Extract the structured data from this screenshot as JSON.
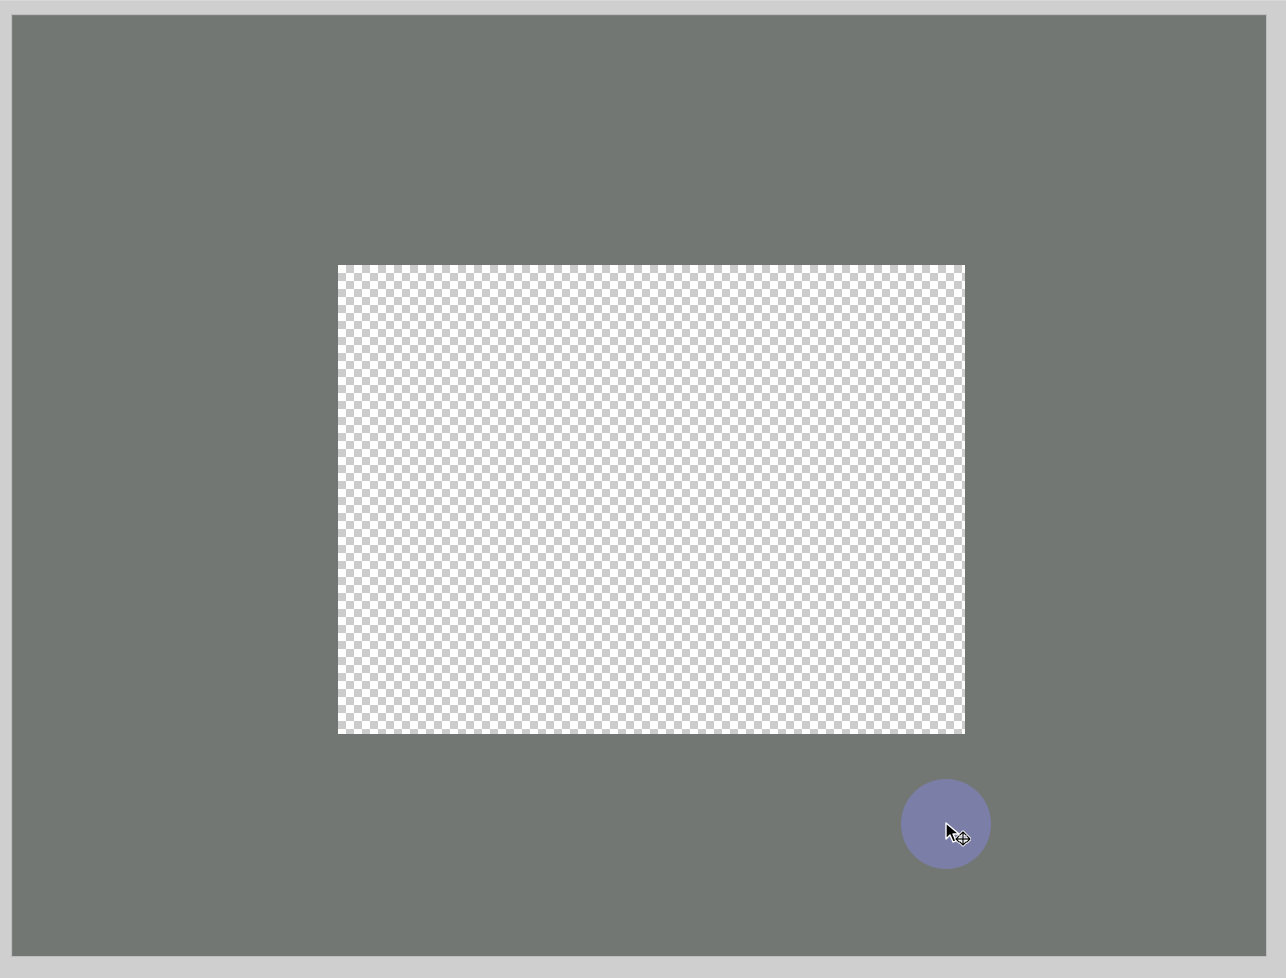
{
  "window": {
    "background_color": "#cfcfcf"
  },
  "workspace": {
    "pasteboard_color": "#727774",
    "canvas": {
      "type": "transparent-layer",
      "checker_light": "#ffffff",
      "checker_dark": "#cccccc"
    }
  },
  "cursor": {
    "icon": "move-arrow-icon",
    "highlight_color": "#7b80ab"
  }
}
